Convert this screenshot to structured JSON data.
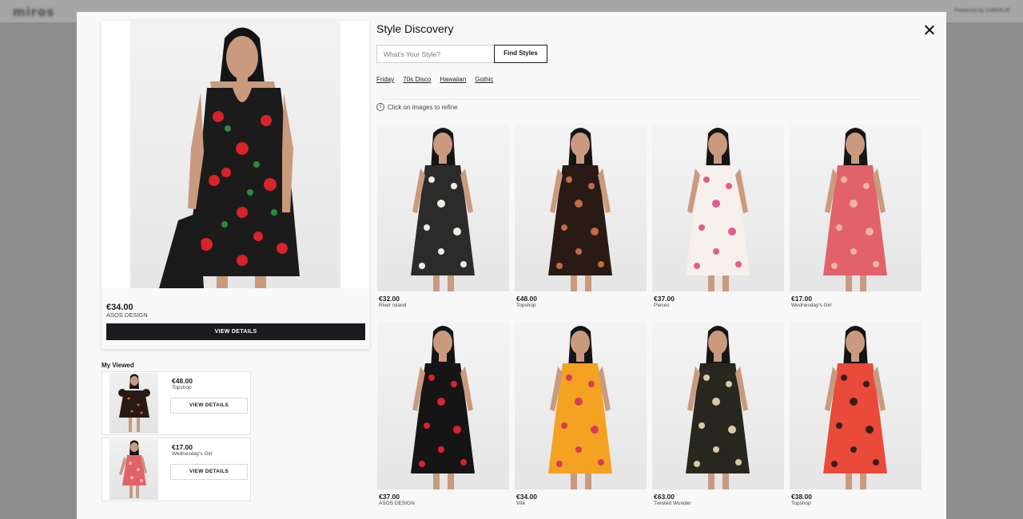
{
  "background_page": {
    "logo": "miros",
    "powered_by": "Powered by VIBRAUE"
  },
  "modal": {
    "title": "Style Discovery",
    "search": {
      "placeholder": "What's Your Style?",
      "value": "",
      "button_label": "Find Styles"
    },
    "style_chips": [
      "Friday",
      "70s Disco",
      "Hawaiian",
      "Gothic"
    ],
    "hint": "Click on images to refine",
    "selected_product": {
      "price": "€34.00",
      "brand": "ASOS DESIGN",
      "button_label": "VIEW DETAILS",
      "dress_color": "#1b1b1b",
      "pattern_color": "#d8232a"
    },
    "my_viewed": {
      "title": "My Viewed",
      "items": [
        {
          "price": "€48.00",
          "brand": "Topshop",
          "button_label": "VIEW DETAILS",
          "dress_color": "#2a1a16",
          "pattern_color": "#c46a45"
        },
        {
          "price": "€17.00",
          "brand": "Wednesday's Girl",
          "button_label": "VIEW DETAILS",
          "dress_color": "#e2626b",
          "pattern_color": "#f3b2a3"
        }
      ]
    },
    "results": [
      {
        "price": "€32.00",
        "brand": "River Island",
        "dress_color": "#2b2b2b",
        "pattern_color": "#efefe6"
      },
      {
        "price": "€48.00",
        "brand": "Topshop",
        "dress_color": "#2a1a16",
        "pattern_color": "#c46a45"
      },
      {
        "price": "€37.00",
        "brand": "Pieces",
        "dress_color": "#f6f0ec",
        "pattern_color": "#e25c8f"
      },
      {
        "price": "€17.00",
        "brand": "Wednesday's Girl",
        "dress_color": "#e2626b",
        "pattern_color": "#f3b2a3"
      },
      {
        "price": "€37.00",
        "brand": "ASOS DESIGN",
        "dress_color": "#151515",
        "pattern_color": "#d8232a"
      },
      {
        "price": "€34.00",
        "brand": "Vila",
        "dress_color": "#f3a321",
        "pattern_color": "#d93a57"
      },
      {
        "price": "€63.00",
        "brand": "Twisted Wunder",
        "dress_color": "#27261f",
        "pattern_color": "#d9c7a6"
      },
      {
        "price": "€38.00",
        "brand": "Topshop",
        "dress_color": "#e94a3a",
        "pattern_color": "#3a1e18"
      }
    ]
  }
}
